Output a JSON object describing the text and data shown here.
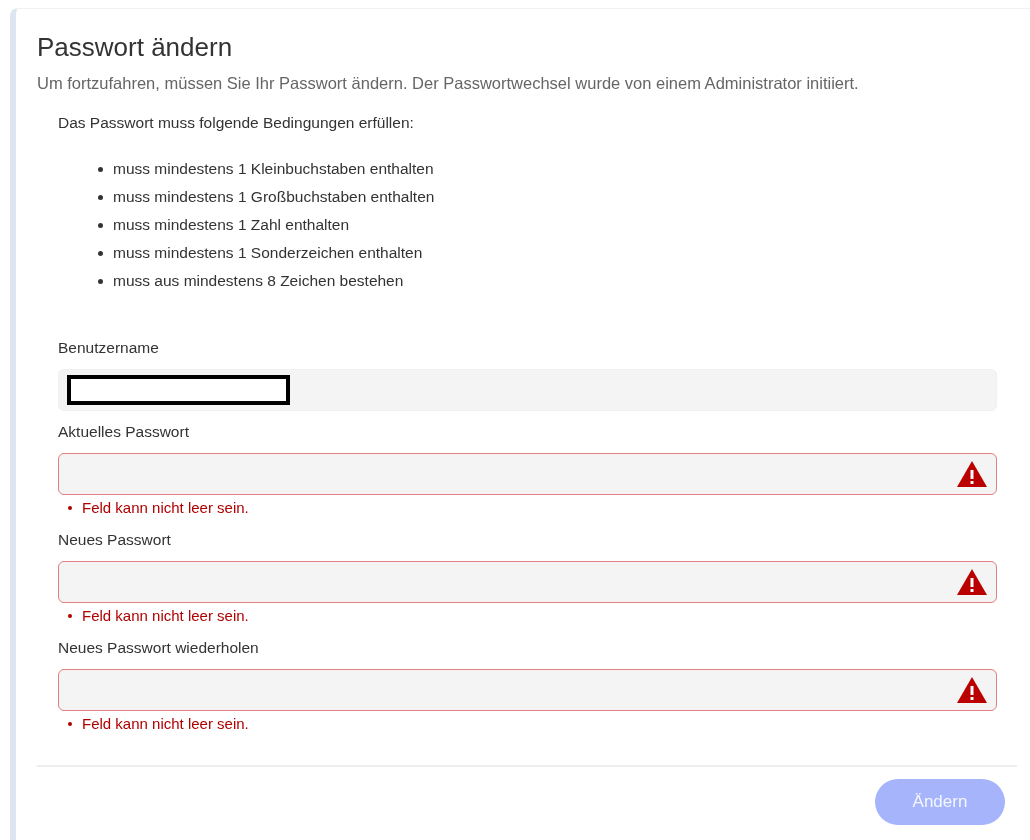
{
  "title": "Passwort ändern",
  "intro": "Um fortzufahren, müssen Sie Ihr Passwort ändern. Der Passwortwechsel wurde von einem Administrator initiiert.",
  "rules_heading": "Das Passwort muss folgende Bedingungen erfüllen:",
  "rules": [
    "muss mindestens 1 Kleinbuchstaben enthalten",
    "muss mindestens 1 Großbuchstaben enthalten",
    "muss mindestens 1 Zahl enthalten",
    "muss mindestens 1 Sonderzeichen enthalten",
    "muss aus mindestens 8 Zeichen bestehen"
  ],
  "fields": [
    {
      "label": "Benutzername",
      "redacted": true,
      "invalid": false
    },
    {
      "label": "Aktuelles Passwort",
      "invalid": true,
      "error": "Feld kann nicht leer sein."
    },
    {
      "label": "Neues Passwort",
      "invalid": true,
      "error": "Feld kann nicht leer sein."
    },
    {
      "label": "Neues Passwort wiederholen",
      "invalid": true,
      "error": "Feld kann nicht leer sein."
    }
  ],
  "submit": {
    "label": "Ändern",
    "disabled": true
  }
}
